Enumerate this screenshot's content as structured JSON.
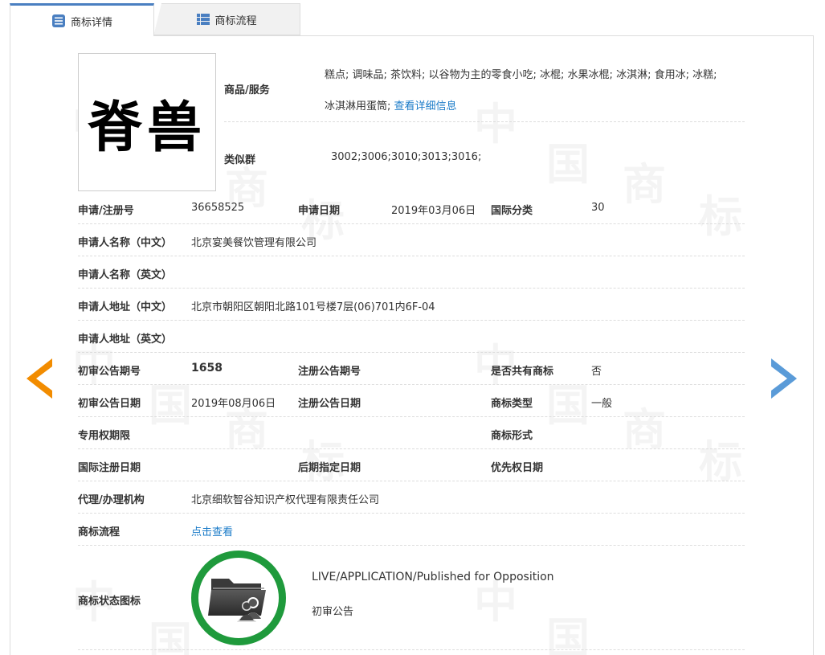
{
  "tabs": [
    {
      "label": "商标详情",
      "icon": "list-detail-icon",
      "active": true
    },
    {
      "label": "商标流程",
      "icon": "grid-list-icon",
      "active": false
    }
  ],
  "watermark": {
    "chars": [
      "中",
      "国",
      "商",
      "标"
    ]
  },
  "logo": {
    "text": "脊兽"
  },
  "goods": {
    "label": "商品/服务",
    "line1": "糕点; 调味品; 茶饮料; 以谷物为主的零食小吃; 冰棍; 水果冰棍; 冰淇淋; 食用冰; 冰糕;",
    "line2": "冰淇淋用蛋筒;",
    "detail_link": "查看详细信息"
  },
  "similar_group": {
    "label": "类似群",
    "value": "3002;3006;3010;3013;3016;"
  },
  "fields": {
    "reg_no_label": "申请/注册号",
    "reg_no": "36658525",
    "apply_date_label": "申请日期",
    "apply_date": "2019年03月06日",
    "intl_class_label": "国际分类",
    "intl_class": "30",
    "applicant_cn_label": "申请人名称（中文）",
    "applicant_cn": "北京宴美餐饮管理有限公司",
    "applicant_en_label": "申请人名称（英文）",
    "applicant_en": "",
    "address_cn_label": "申请人地址（中文）",
    "address_cn": "北京市朝阳区朝阳北路101号楼7层(06)701内6F-04",
    "address_en_label": "申请人地址（英文）",
    "address_en": "",
    "prelim_issue_label": "初审公告期号",
    "prelim_issue": "1658",
    "reg_issue_label": "注册公告期号",
    "reg_issue": "",
    "shared_label": "是否共有商标",
    "shared": "否",
    "prelim_date_label": "初审公告日期",
    "prelim_date": "2019年08月06日",
    "reg_date_label": "注册公告日期",
    "reg_date": "",
    "mark_type_label": "商标类型",
    "mark_type": "一般",
    "exclusive_term_label": "专用权期限",
    "exclusive_term": "",
    "mark_form_label": "商标形式",
    "mark_form": "",
    "intl_reg_date_label": "国际注册日期",
    "intl_reg_date": "",
    "later_design_label": "后期指定日期",
    "later_design": "",
    "priority_date_label": "优先权日期",
    "priority_date": "",
    "agency_label": "代理/办理机构",
    "agency": "北京细软智谷知识产权代理有限责任公司",
    "process_label": "商标流程",
    "process_link": "点击查看",
    "status_icon_label": "商标状态图标",
    "status_en": "LIVE/APPLICATION/Published for Opposition",
    "status_cn": "初审公告"
  },
  "colors": {
    "accent": "#4a7fc1",
    "link": "#1a7bc8",
    "arrow_left": "#f28c00",
    "arrow_right": "#5a9bd8",
    "status_ring": "#1f9a3c"
  },
  "nav": {
    "prev_icon": "arrow-left-icon",
    "next_icon": "arrow-right-icon"
  }
}
